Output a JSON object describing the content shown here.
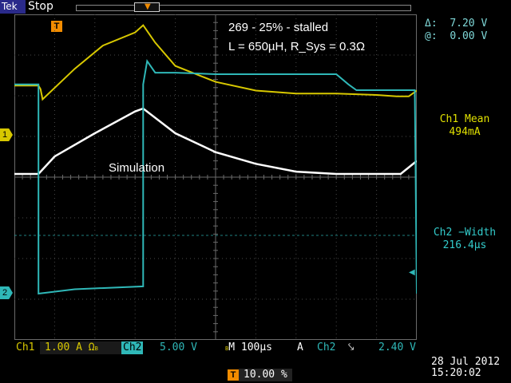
{
  "header": {
    "brand": "Tek",
    "run_state": "Stop"
  },
  "cursors": {
    "delta_label": "Δ:",
    "delta_value": "7.20 V",
    "at_label": "@:",
    "at_value": "0.00 V"
  },
  "measurements": [
    {
      "label": "Ch1 Mean",
      "value": "494mA"
    },
    {
      "label": "Ch2 −Width",
      "value": "216.4µs"
    }
  ],
  "annotations": {
    "title": "269 - 25% - stalled",
    "params": "L = 650µH, R_Sys = 0.3Ω",
    "sim_label": "Simulation"
  },
  "channel_markers": {
    "ch1": "1",
    "ch2": "2",
    "trigger": "T"
  },
  "bottom": {
    "ch1_label": "Ch1",
    "ch1_scale": "1.00 A",
    "ch1_coupling": "Ω",
    "ch1_bw": "B",
    "ch2_label": "Ch2",
    "ch2_scale": "5.00 V",
    "ch2_bw": "B",
    "timebase_mode": "M",
    "timebase": "100µs",
    "trigger_src_label": "A",
    "trigger_channel": "Ch2",
    "trigger_slope": "⤥",
    "trigger_level": "2.40 V",
    "trigger_position": "10.00 %",
    "date": "28 Jul  2012",
    "time": "15:20:02"
  },
  "colors": {
    "ch1": "#d8c800",
    "ch2": "#2fb8b8",
    "simulation": "#ffffff",
    "trigger": "#f28c00",
    "grid": "#5a5a5a"
  },
  "chart_data": {
    "type": "line",
    "x_divisions": 10,
    "y_divisions": 8,
    "series": [
      {
        "name": "Ch1",
        "color": "#d8c800",
        "x": [
          0.0,
          0.6,
          0.65,
          0.7,
          1.5,
          2.2,
          3.0,
          3.2,
          3.5,
          4.0,
          5.0,
          6.0,
          7.0,
          8.0,
          9.0,
          9.5,
          9.6,
          9.8,
          10.0
        ],
        "y": [
          1.72,
          1.72,
          1.6,
          1.25,
          2.3,
          3.1,
          3.55,
          3.8,
          3.2,
          2.4,
          1.85,
          1.55,
          1.45,
          1.45,
          1.4,
          1.35,
          1.35,
          1.35,
          1.55
        ]
      },
      {
        "name": "Simulation",
        "color": "#ffffff",
        "x": [
          0.0,
          0.6,
          1.0,
          2.0,
          3.0,
          3.2,
          4.0,
          5.0,
          6.0,
          7.0,
          8.0,
          9.0,
          9.6,
          10.0
        ],
        "y": [
          0.0,
          0.0,
          0.6,
          1.4,
          2.15,
          2.25,
          1.4,
          0.75,
          0.35,
          0.08,
          0.0,
          0.0,
          0.0,
          0.45
        ]
      },
      {
        "name": "Ch2",
        "color": "#2fb8b8",
        "x": [
          0.0,
          0.55,
          0.6,
          0.6,
          1.5,
          3.2,
          3.2,
          3.3,
          3.5,
          4.0,
          5.0,
          6.0,
          7.0,
          8.0,
          8.3,
          8.5,
          9.0,
          9.95,
          10.0
        ],
        "y": [
          7.2,
          7.2,
          7.2,
          0.0,
          0.15,
          0.25,
          7.2,
          8.0,
          7.6,
          7.6,
          7.55,
          7.55,
          7.55,
          7.55,
          7.2,
          7.0,
          7.0,
          7.0,
          0.0
        ]
      }
    ]
  }
}
